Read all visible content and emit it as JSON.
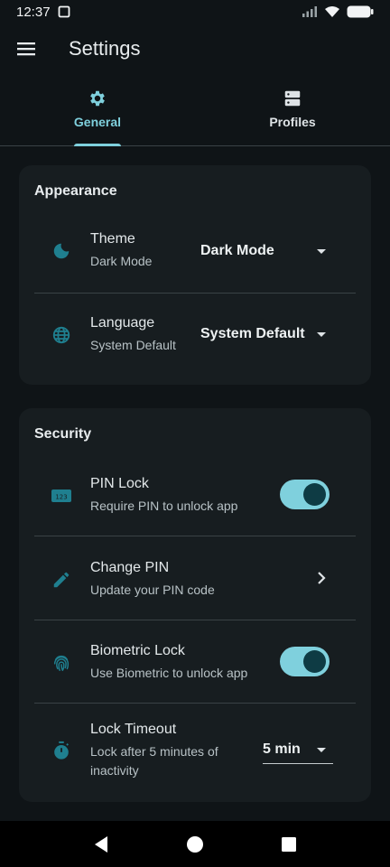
{
  "status_bar": {
    "time": "12:37"
  },
  "app_bar": {
    "title": "Settings"
  },
  "tabs": [
    {
      "label": "General",
      "active": true
    },
    {
      "label": "Profiles",
      "active": false
    }
  ],
  "appearance": {
    "title": "Appearance",
    "theme": {
      "title": "Theme",
      "subtitle": "Dark Mode",
      "value": "Dark Mode"
    },
    "language": {
      "title": "Language",
      "subtitle": "System Default",
      "value": "System Default"
    }
  },
  "security": {
    "title": "Security",
    "pin_lock": {
      "title": "PIN Lock",
      "subtitle": "Require PIN to unlock app",
      "enabled": true
    },
    "change_pin": {
      "title": "Change PIN",
      "subtitle": "Update your PIN code"
    },
    "biometric_lock": {
      "title": "Biometric Lock",
      "subtitle": "Use Biometric to unlock app",
      "enabled": true
    },
    "lock_timeout": {
      "title": "Lock Timeout",
      "subtitle": "Lock after 5 minutes of inactivity",
      "value": "5 min"
    }
  },
  "colors": {
    "accent": "#7fd0dd",
    "icon_teal": "#1f7f8f",
    "background": "#0f1417",
    "card": "#171d20"
  }
}
